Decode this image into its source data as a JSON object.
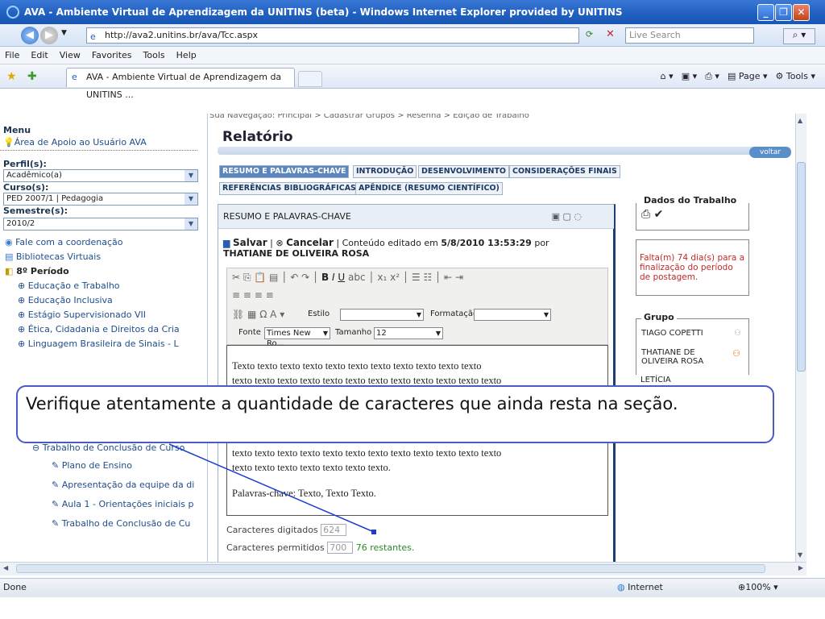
{
  "window": {
    "title": "AVA - Ambiente Virtual de Aprendizagem da UNITINS (beta) - Windows Internet Explorer provided by UNITINS"
  },
  "address": {
    "url": "http://ava2.unitins.br/ava/Tcc.aspx",
    "search_placeholder": "Live Search"
  },
  "menu": [
    "File",
    "Edit",
    "View",
    "Favorites",
    "Tools",
    "Help"
  ],
  "tab": {
    "label": "AVA - Ambiente Virtual de Aprendizagem da UNITINS ..."
  },
  "cmdbar": {
    "page": "Page",
    "tools": "Tools"
  },
  "breadcrumb": "Sua Navegação: Principal > Cadastrar Grupos > Resenha > Edição de Trabalho",
  "left": {
    "menu_title": "Menu",
    "help": "Área de Apoio ao Usuário AVA",
    "perfil_label": "Perfil(s):",
    "perfil_value": "Acadêmico(a)",
    "curso_label": "Curso(s):",
    "curso_value": "PED 2007/1 | Pedagogia",
    "semestre_label": "Semestre(s):",
    "semestre_value": "2010/2",
    "links": [
      "Fale com a coordenação",
      "Bibliotecas Virtuais"
    ],
    "periodo": "8º Período",
    "subjects": [
      "Educação e Trabalho",
      "Educação Inclusiva",
      "Estágio Supervisionado VII",
      "Ética, Cidadania e Direitos da Cria",
      "Linguagem Brasileira de Sinais - L",
      "Trabalho de Conclusão de Curso"
    ],
    "subitems": [
      "Plano de Ensino",
      "Apresentação da equipe da di",
      "Aula 1 - Orientações iniciais p",
      "Trabalho de Conclusão de Cu"
    ]
  },
  "main": {
    "title": "Relatório",
    "voltar": "voltar",
    "tabs_row1": [
      "RESUMO E PALAVRAS-CHAVE",
      "INTRODUÇÃO",
      "DESENVOLVIMENTO",
      "CONSIDERAÇÕES FINAIS"
    ],
    "tabs_row2": [
      "REFERÊNCIAS BIBLIOGRÁFICAS",
      "APÊNDICE (RESUMO CIENTÍFICO)"
    ],
    "section_title": "RESUMO E PALAVRAS-CHAVE",
    "salvar": "Salvar",
    "cancelar": "Cancelar",
    "edited_prefix": "Conteúdo editado em",
    "edited_date": "5/8/2010 13:53:29",
    "edited_by": "por",
    "author": "THATIANE DE OLIVEIRA ROSA",
    "estilo": "Estilo",
    "formatacao": "Formatação",
    "fonte": "Fonte",
    "fonte_value": "Times New Ro...",
    "tamanho": "Tamanho",
    "tamanho_value": "12",
    "text_lines": [
      "Texto texto texto texto texto texto texto texto texto texto texto",
      "texto texto texto texto texto texto texto texto texto texto texto texto"
    ],
    "text_lines_bottom": [
      "texto texto texto texto texto texto texto texto texto texto texto texto",
      "texto texto texto texto texto texto texto."
    ],
    "keywords": "Palavras-chave: Texto, Texto Texto.",
    "chars_typed_label": "Caracteres digitados",
    "chars_typed": "624",
    "chars_allowed_label": "Caracteres permitidos",
    "chars_allowed": "700",
    "remaining": "76 restantes."
  },
  "right": {
    "dados_title": "Dados do Trabalho",
    "deadline": "Falta(m) 74 dia(s) para a finalização do período de postagem.",
    "grupo_title": "Grupo",
    "members": [
      "TIAGO COPETTI",
      "THATIANE DE OLIVEIRA ROSA",
      "LETÍCIA"
    ]
  },
  "callout": "Verifique atentamente a quantidade de caracteres que ainda resta na seção.",
  "status": {
    "left": "Done",
    "zone": "Internet",
    "zoom": "100%"
  }
}
